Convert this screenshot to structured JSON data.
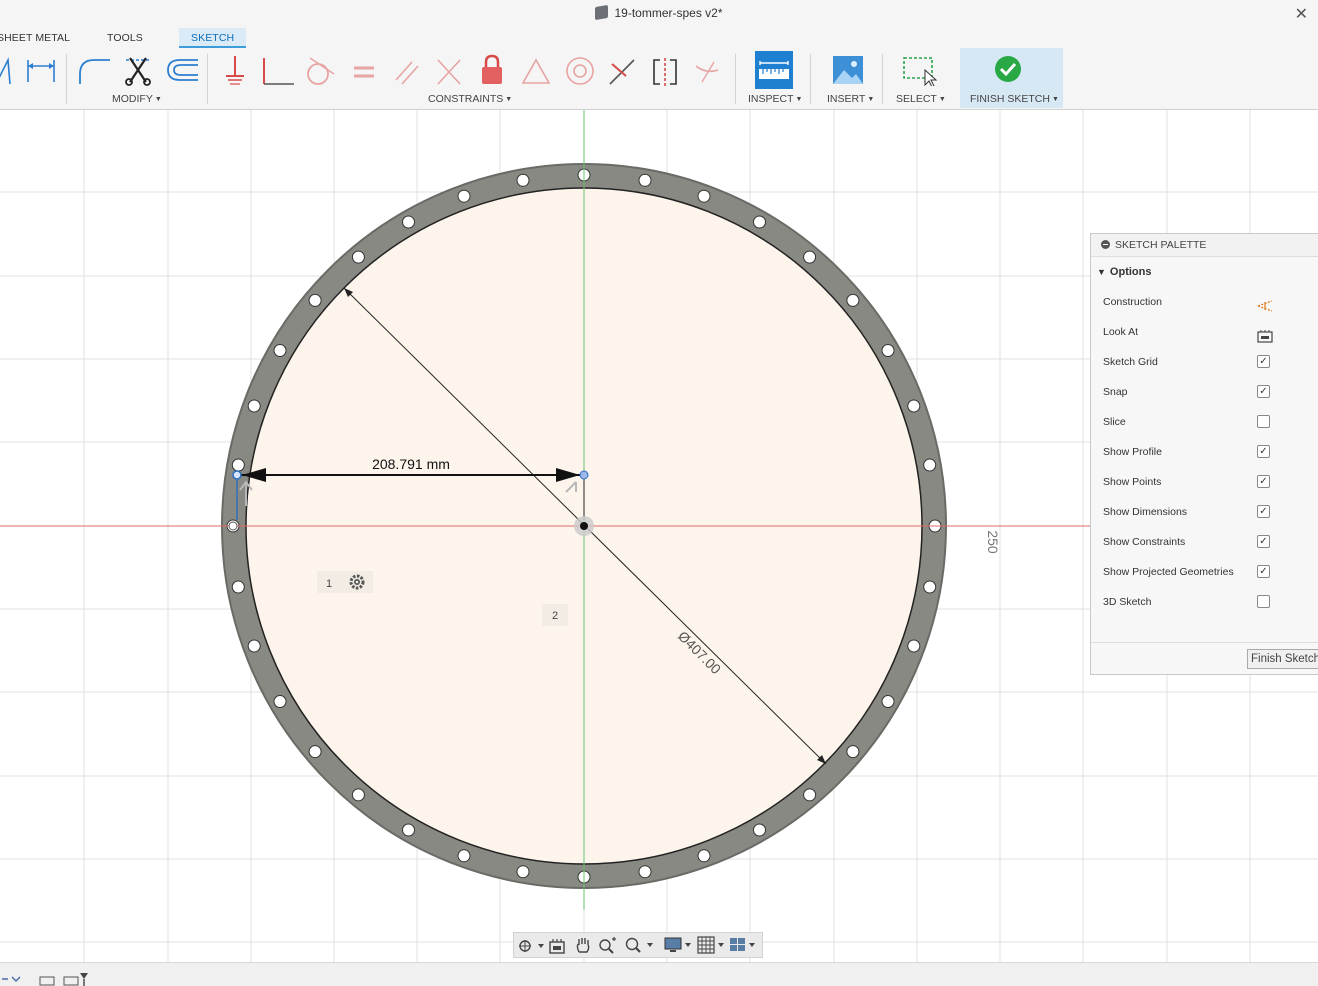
{
  "window": {
    "title": "19-tommer-spes v2*",
    "close_icon": "close-icon"
  },
  "tabs": [
    {
      "label": "SHEET METAL",
      "active": false
    },
    {
      "label": "TOOLS",
      "active": false
    },
    {
      "label": "SKETCH",
      "active": true
    }
  ],
  "ribbon": {
    "groups": {
      "modify": "MODIFY",
      "constraints": "CONSTRAINTS",
      "inspect": "INSPECT",
      "insert": "INSERT",
      "select": "SELECT",
      "finish": "FINISH SKETCH"
    },
    "icons": [
      "triangle-line-icon",
      "dimension-icon",
      "fillet-icon",
      "trim-icon",
      "offset-icon",
      "fix-icon",
      "perpendicular-icon",
      "tangent-icon",
      "equal-icon",
      "parallel-icon",
      "collinear-icon",
      "lock-icon",
      "triangle-icon",
      "concentric-icon",
      "midpoint-icon",
      "symmetry-icon",
      "curvature-icon",
      "measure-icon",
      "insert-image-icon",
      "select-icon",
      "finish-sketch-check-icon"
    ]
  },
  "sketch": {
    "dimension_radius_label": "208.791 mm",
    "dimension_diameter_label": "Ø407.00",
    "vertical_dimension_label": "250",
    "profile_badge_1": "1",
    "profile_badge_2": "2",
    "colors": {
      "flange": "#898983",
      "profile_fill": "#fdf5ec",
      "x_axis": "#e06a6a",
      "y_axis": "#6bc46b",
      "selection": "#2c6fbf"
    }
  },
  "palette": {
    "title": "SKETCH PALETTE",
    "section": "Options",
    "rows": [
      {
        "label": "Construction",
        "type": "icon",
        "icon": "construction-icon"
      },
      {
        "label": "Look At",
        "type": "icon",
        "icon": "look-at-icon"
      },
      {
        "label": "Sketch Grid",
        "type": "checkbox",
        "checked": true
      },
      {
        "label": "Snap",
        "type": "checkbox",
        "checked": true
      },
      {
        "label": "Slice",
        "type": "checkbox",
        "checked": false
      },
      {
        "label": "Show Profile",
        "type": "checkbox",
        "checked": true
      },
      {
        "label": "Show Points",
        "type": "checkbox",
        "checked": true
      },
      {
        "label": "Show Dimensions",
        "type": "checkbox",
        "checked": true
      },
      {
        "label": "Show Constraints",
        "type": "checkbox",
        "checked": true
      },
      {
        "label": "Show Projected Geometries",
        "type": "checkbox",
        "checked": true
      },
      {
        "label": "3D Sketch",
        "type": "checkbox",
        "checked": false
      }
    ],
    "finish_button": "Finish Sketch"
  },
  "navbar": {
    "icons": [
      "orbit-icon",
      "look-at-icon",
      "pan-icon",
      "zoom-window-icon",
      "zoom-icon",
      "display-settings-icon",
      "grid-settings-icon",
      "viewports-icon"
    ]
  }
}
